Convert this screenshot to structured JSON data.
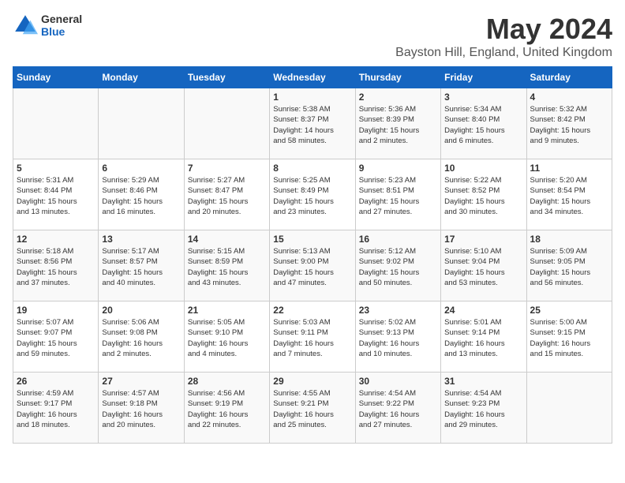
{
  "header": {
    "logo_general": "General",
    "logo_blue": "Blue",
    "month_year": "May 2024",
    "location": "Bayston Hill, England, United Kingdom"
  },
  "weekdays": [
    "Sunday",
    "Monday",
    "Tuesday",
    "Wednesday",
    "Thursday",
    "Friday",
    "Saturday"
  ],
  "weeks": [
    [
      {
        "day": "",
        "info": ""
      },
      {
        "day": "",
        "info": ""
      },
      {
        "day": "",
        "info": ""
      },
      {
        "day": "1",
        "info": "Sunrise: 5:38 AM\nSunset: 8:37 PM\nDaylight: 14 hours\nand 58 minutes."
      },
      {
        "day": "2",
        "info": "Sunrise: 5:36 AM\nSunset: 8:39 PM\nDaylight: 15 hours\nand 2 minutes."
      },
      {
        "day": "3",
        "info": "Sunrise: 5:34 AM\nSunset: 8:40 PM\nDaylight: 15 hours\nand 6 minutes."
      },
      {
        "day": "4",
        "info": "Sunrise: 5:32 AM\nSunset: 8:42 PM\nDaylight: 15 hours\nand 9 minutes."
      }
    ],
    [
      {
        "day": "5",
        "info": "Sunrise: 5:31 AM\nSunset: 8:44 PM\nDaylight: 15 hours\nand 13 minutes."
      },
      {
        "day": "6",
        "info": "Sunrise: 5:29 AM\nSunset: 8:46 PM\nDaylight: 15 hours\nand 16 minutes."
      },
      {
        "day": "7",
        "info": "Sunrise: 5:27 AM\nSunset: 8:47 PM\nDaylight: 15 hours\nand 20 minutes."
      },
      {
        "day": "8",
        "info": "Sunrise: 5:25 AM\nSunset: 8:49 PM\nDaylight: 15 hours\nand 23 minutes."
      },
      {
        "day": "9",
        "info": "Sunrise: 5:23 AM\nSunset: 8:51 PM\nDaylight: 15 hours\nand 27 minutes."
      },
      {
        "day": "10",
        "info": "Sunrise: 5:22 AM\nSunset: 8:52 PM\nDaylight: 15 hours\nand 30 minutes."
      },
      {
        "day": "11",
        "info": "Sunrise: 5:20 AM\nSunset: 8:54 PM\nDaylight: 15 hours\nand 34 minutes."
      }
    ],
    [
      {
        "day": "12",
        "info": "Sunrise: 5:18 AM\nSunset: 8:56 PM\nDaylight: 15 hours\nand 37 minutes."
      },
      {
        "day": "13",
        "info": "Sunrise: 5:17 AM\nSunset: 8:57 PM\nDaylight: 15 hours\nand 40 minutes."
      },
      {
        "day": "14",
        "info": "Sunrise: 5:15 AM\nSunset: 8:59 PM\nDaylight: 15 hours\nand 43 minutes."
      },
      {
        "day": "15",
        "info": "Sunrise: 5:13 AM\nSunset: 9:00 PM\nDaylight: 15 hours\nand 47 minutes."
      },
      {
        "day": "16",
        "info": "Sunrise: 5:12 AM\nSunset: 9:02 PM\nDaylight: 15 hours\nand 50 minutes."
      },
      {
        "day": "17",
        "info": "Sunrise: 5:10 AM\nSunset: 9:04 PM\nDaylight: 15 hours\nand 53 minutes."
      },
      {
        "day": "18",
        "info": "Sunrise: 5:09 AM\nSunset: 9:05 PM\nDaylight: 15 hours\nand 56 minutes."
      }
    ],
    [
      {
        "day": "19",
        "info": "Sunrise: 5:07 AM\nSunset: 9:07 PM\nDaylight: 15 hours\nand 59 minutes."
      },
      {
        "day": "20",
        "info": "Sunrise: 5:06 AM\nSunset: 9:08 PM\nDaylight: 16 hours\nand 2 minutes."
      },
      {
        "day": "21",
        "info": "Sunrise: 5:05 AM\nSunset: 9:10 PM\nDaylight: 16 hours\nand 4 minutes."
      },
      {
        "day": "22",
        "info": "Sunrise: 5:03 AM\nSunset: 9:11 PM\nDaylight: 16 hours\nand 7 minutes."
      },
      {
        "day": "23",
        "info": "Sunrise: 5:02 AM\nSunset: 9:13 PM\nDaylight: 16 hours\nand 10 minutes."
      },
      {
        "day": "24",
        "info": "Sunrise: 5:01 AM\nSunset: 9:14 PM\nDaylight: 16 hours\nand 13 minutes."
      },
      {
        "day": "25",
        "info": "Sunrise: 5:00 AM\nSunset: 9:15 PM\nDaylight: 16 hours\nand 15 minutes."
      }
    ],
    [
      {
        "day": "26",
        "info": "Sunrise: 4:59 AM\nSunset: 9:17 PM\nDaylight: 16 hours\nand 18 minutes."
      },
      {
        "day": "27",
        "info": "Sunrise: 4:57 AM\nSunset: 9:18 PM\nDaylight: 16 hours\nand 20 minutes."
      },
      {
        "day": "28",
        "info": "Sunrise: 4:56 AM\nSunset: 9:19 PM\nDaylight: 16 hours\nand 22 minutes."
      },
      {
        "day": "29",
        "info": "Sunrise: 4:55 AM\nSunset: 9:21 PM\nDaylight: 16 hours\nand 25 minutes."
      },
      {
        "day": "30",
        "info": "Sunrise: 4:54 AM\nSunset: 9:22 PM\nDaylight: 16 hours\nand 27 minutes."
      },
      {
        "day": "31",
        "info": "Sunrise: 4:54 AM\nSunset: 9:23 PM\nDaylight: 16 hours\nand 29 minutes."
      },
      {
        "day": "",
        "info": ""
      }
    ]
  ]
}
